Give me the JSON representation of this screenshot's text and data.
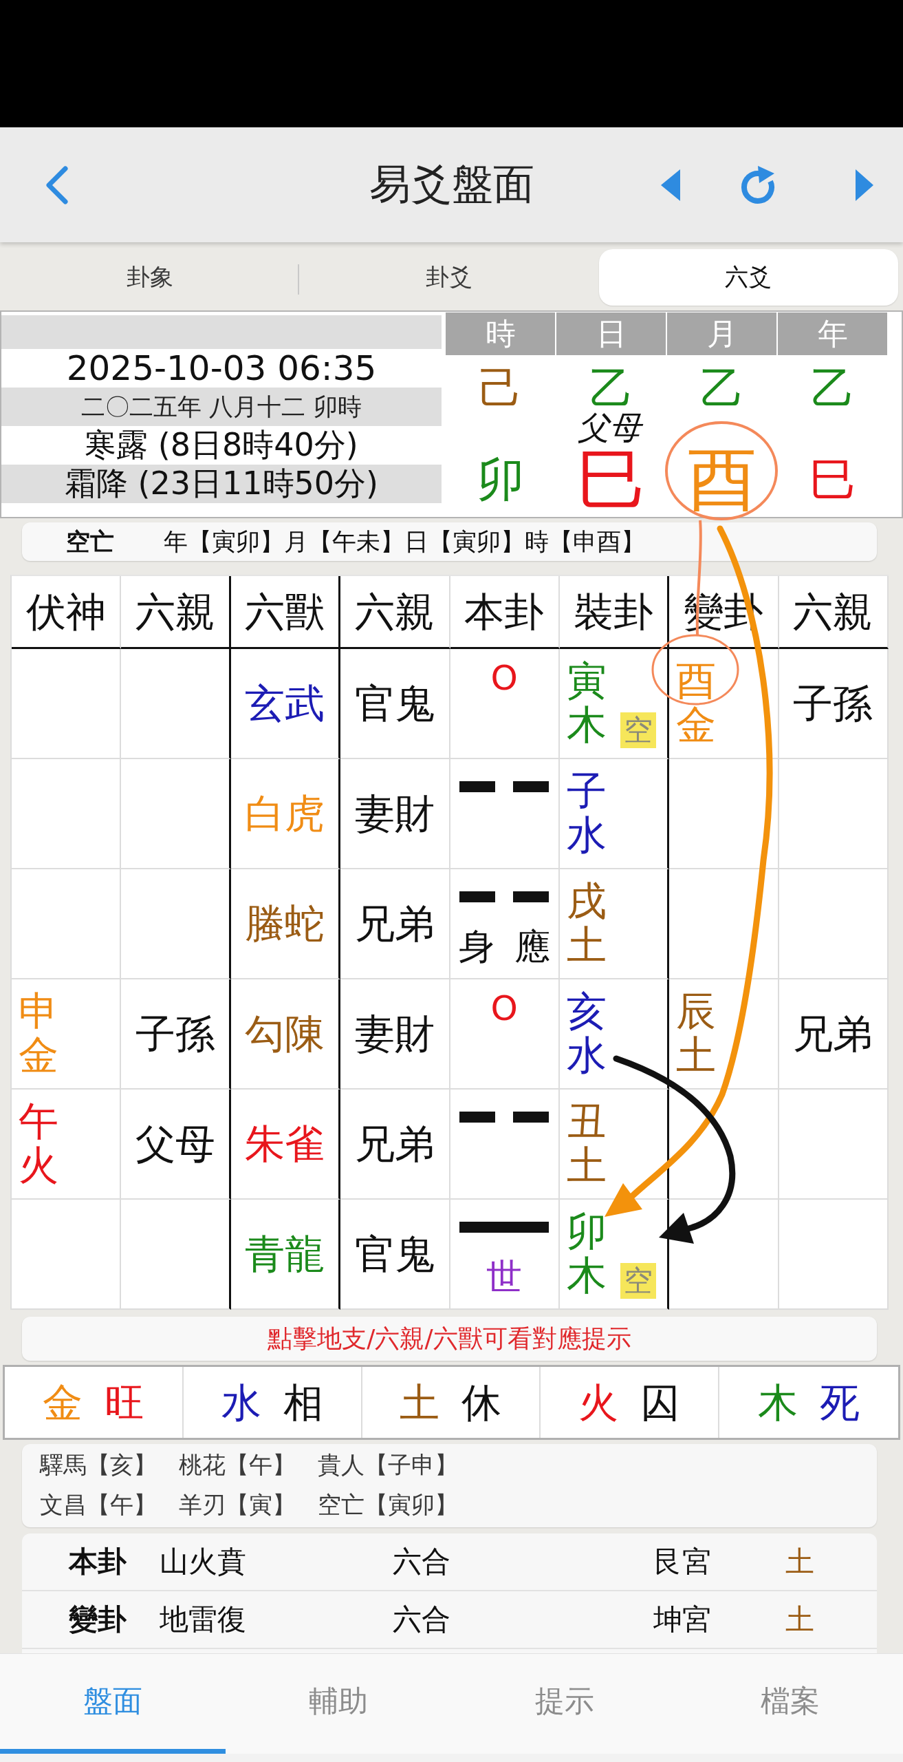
{
  "header": {
    "title": "易爻盤面"
  },
  "tabs": [
    {
      "label": "卦象",
      "selected": false
    },
    {
      "label": "卦爻",
      "selected": false
    },
    {
      "label": "六爻",
      "selected": true
    }
  ],
  "info": {
    "datetime": "2025-10-03 06:35",
    "lunar_date": "二〇二五年 八月十二 卯時",
    "solar_terms": [
      "寒露 (8日8時40分)",
      "霜降 (23日11時50分)"
    ],
    "pillars": [
      {
        "label": "時",
        "stem": {
          "text": "己",
          "color": "#9b5c14"
        },
        "branch": {
          "text": "卯",
          "color": "#1b8a1b",
          "emphasized": false
        }
      },
      {
        "label": "日",
        "stem": {
          "text": "乙",
          "color": "#1b8a1b"
        },
        "branch": {
          "text": "巳",
          "color": "#e8161c",
          "emphasized": true
        }
      },
      {
        "label": "月",
        "stem": {
          "text": "乙",
          "color": "#1b8a1b"
        },
        "branch": {
          "text": "酉",
          "color": "#f08c14",
          "emphasized": true
        }
      },
      {
        "label": "年",
        "stem": {
          "text": "乙",
          "color": "#1b8a1b"
        },
        "branch": {
          "text": "巳",
          "color": "#e8161c",
          "emphasized": false
        }
      }
    ]
  },
  "void_bar": {
    "label": "空亡",
    "text": "年【寅卯】月【午未】日【寅卯】時【申酉】"
  },
  "table": {
    "columns": [
      "伏神",
      "六親",
      "六獸",
      "六親",
      "本卦",
      "裝卦",
      "變卦",
      "六親"
    ],
    "rows": [
      {
        "beast": {
          "text": "玄武",
          "color": "#1c1cb4"
        },
        "relation": "官鬼",
        "line": {
          "kind": "moving",
          "text": "O"
        },
        "najia": {
          "text": "寅木",
          "color": "#1b8a1b"
        },
        "void_mark": "空",
        "changed": {
          "text": "酉金",
          "color": "#f08c14"
        },
        "changed_relation": "子孫"
      },
      {
        "beast": {
          "text": "白虎",
          "color": "#f08c14"
        },
        "relation": "妻財",
        "line": {
          "kind": "yin"
        },
        "najia": {
          "text": "子水",
          "color": "#1c1cb4"
        }
      },
      {
        "beast": {
          "text": "螣蛇",
          "color": "#9b5c14"
        },
        "relation": "兄弟",
        "line": {
          "kind": "yin"
        },
        "tags": [
          {
            "text": "身",
            "color": "#111111"
          },
          {
            "text": "應",
            "color": "#111111"
          }
        ],
        "najia": {
          "text": "戌土",
          "color": "#9b5c14"
        }
      },
      {
        "hidden": {
          "text": "申金",
          "color": "#f08c14"
        },
        "hidden_relation": "子孫",
        "beast": {
          "text": "勾陳",
          "color": "#9b5c14"
        },
        "relation": "妻財",
        "line": {
          "kind": "moving",
          "text": "O"
        },
        "najia": {
          "text": "亥水",
          "color": "#1c1cb4"
        },
        "changed": {
          "text": "辰土",
          "color": "#9b5c14"
        },
        "changed_relation": "兄弟"
      },
      {
        "hidden": {
          "text": "午火",
          "color": "#e8161c"
        },
        "hidden_relation": "父母",
        "beast": {
          "text": "朱雀",
          "color": "#e8161c"
        },
        "relation": "兄弟",
        "line": {
          "kind": "yin"
        },
        "najia": {
          "text": "丑土",
          "color": "#9b5c14"
        }
      },
      {
        "beast": {
          "text": "青龍",
          "color": "#1b8a1b"
        },
        "relation": "官鬼",
        "line": {
          "kind": "yang"
        },
        "tags": [
          {
            "text": "世",
            "color": "#8e2fc8"
          }
        ],
        "najia": {
          "text": "卯木",
          "color": "#1b8a1b"
        },
        "void_mark": "空"
      }
    ]
  },
  "hint": "點擊地支/六親/六獸可看對應提示",
  "seasons": [
    {
      "element": {
        "text": "金",
        "color": "#f08c14"
      },
      "state": {
        "text": "旺",
        "color": "#e8161c"
      }
    },
    {
      "element": {
        "text": "水",
        "color": "#1c1cb4"
      },
      "state": {
        "text": "相",
        "color": "#111111"
      }
    },
    {
      "element": {
        "text": "土",
        "color": "#9b5c14"
      },
      "state": {
        "text": "休",
        "color": "#111111"
      }
    },
    {
      "element": {
        "text": "火",
        "color": "#e8161c"
      },
      "state": {
        "text": "囚",
        "color": "#111111"
      }
    },
    {
      "element": {
        "text": "木",
        "color": "#1b8a1b"
      },
      "state": {
        "text": "死",
        "color": "#1c1cb4"
      }
    }
  ],
  "shensha": [
    [
      "驛馬【亥】",
      "桃花【午】",
      "貴人【子申】"
    ],
    [
      "文昌【午】",
      "羊刃【寅】",
      "空亡【寅卯】"
    ]
  ],
  "hexagrams": [
    {
      "label": "本卦",
      "name": "山火賁",
      "relation": "六合",
      "palace": "艮宮",
      "element": {
        "text": "土",
        "color": "#9b5c14"
      }
    },
    {
      "label": "變卦",
      "name": "地雷復",
      "relation": "六合",
      "palace": "坤宮",
      "element": {
        "text": "土",
        "color": "#9b5c14"
      }
    }
  ],
  "bottom_tabs": [
    {
      "label": "盤面",
      "selected": true
    },
    {
      "label": "輔助",
      "selected": false
    },
    {
      "label": "提示",
      "selected": false
    },
    {
      "label": "檔案",
      "selected": false
    }
  ],
  "annotations": {
    "note": "父母"
  }
}
